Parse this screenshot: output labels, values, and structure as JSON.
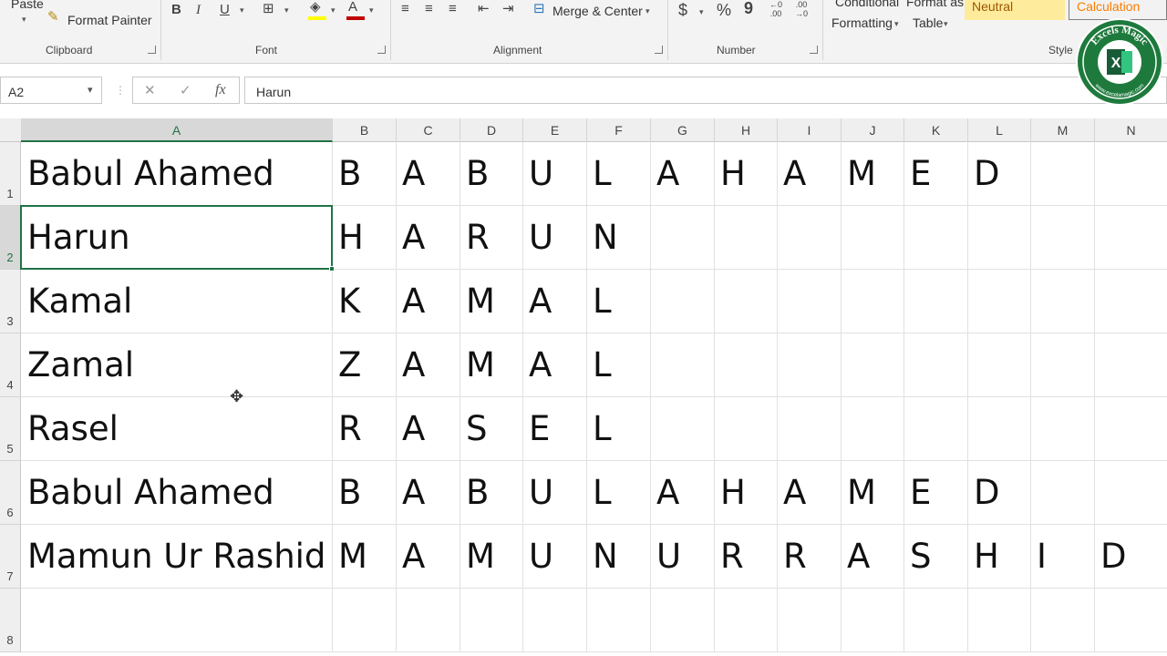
{
  "ribbon": {
    "paste_label": "Paste",
    "format_painter_label": "Format Painter",
    "groups": {
      "clipboard": "Clipboard",
      "font": "Font",
      "alignment": "Alignment",
      "number": "Number",
      "styles": "Style"
    },
    "font_buttons": [
      "B",
      "I",
      "U"
    ],
    "merge_center_label": "Merge & Center",
    "number_buttons": {
      "currency": "$",
      "percent": "%",
      "comma": "9",
      "increase_decimal_top": "←0",
      "increase_decimal_bottom": ".00",
      "decrease_decimal_top": ".00",
      "decrease_decimal_bottom": "→0"
    },
    "conditional_formatting": [
      "Conditional",
      "Formatting"
    ],
    "format_as_table": [
      "Format as",
      "Table"
    ],
    "style_neutral": "Neutral",
    "style_calculation": "Calculation",
    "colors": {
      "neutral_bg": "#ffeb9c",
      "neutral_fg": "#9c5700",
      "calculation_fg": "#fa7d00",
      "highlight": "#ffff00",
      "font_color": "#c00000"
    }
  },
  "formula_bar": {
    "name_box": "A2",
    "cancel_icon": "✕",
    "enter_icon": "✓",
    "fx_icon": "fx",
    "value": "Harun"
  },
  "grid": {
    "columns": [
      "A",
      "B",
      "C",
      "D",
      "E",
      "F",
      "G",
      "H",
      "I",
      "J",
      "K",
      "L",
      "M",
      "N"
    ],
    "rows": [
      "1",
      "2",
      "3",
      "4",
      "5",
      "6",
      "7",
      "8"
    ],
    "active_cell": "A2",
    "selection_color": "#217346",
    "data": [
      [
        "Babul Ahamed",
        "B",
        "A",
        "B",
        "U",
        "L",
        "A",
        "H",
        "A",
        "M",
        "E",
        "D",
        "",
        ""
      ],
      [
        "Harun",
        "H",
        "A",
        "R",
        "U",
        "N",
        "",
        "",
        "",
        "",
        "",
        "",
        "",
        ""
      ],
      [
        "Kamal",
        "K",
        "A",
        "M",
        "A",
        "L",
        "",
        "",
        "",
        "",
        "",
        "",
        "",
        ""
      ],
      [
        "Zamal",
        "Z",
        "A",
        "M",
        "A",
        "L",
        "",
        "",
        "",
        "",
        "",
        "",
        "",
        ""
      ],
      [
        "Rasel",
        "R",
        "A",
        "S",
        "E",
        "L",
        "",
        "",
        "",
        "",
        "",
        "",
        "",
        ""
      ],
      [
        "Babul Ahamed",
        "B",
        "A",
        "B",
        "U",
        "L",
        "A",
        "H",
        "A",
        "M",
        "E",
        "D",
        "",
        ""
      ],
      [
        "Mamun Ur Rashid",
        "M",
        "A",
        "M",
        "U",
        "N",
        "U",
        "R",
        "R",
        "A",
        "S",
        "H",
        "I",
        "D"
      ],
      [
        "",
        "",
        "",
        "",
        "",
        "",
        "",
        "",
        "",
        "",
        "",
        "",
        "",
        ""
      ]
    ]
  },
  "badge": {
    "top_text": "Excels Magic",
    "bottom_text": "www.excelsmagic.com",
    "logo_letter": "X",
    "ring_color": "#1e7a3c"
  }
}
